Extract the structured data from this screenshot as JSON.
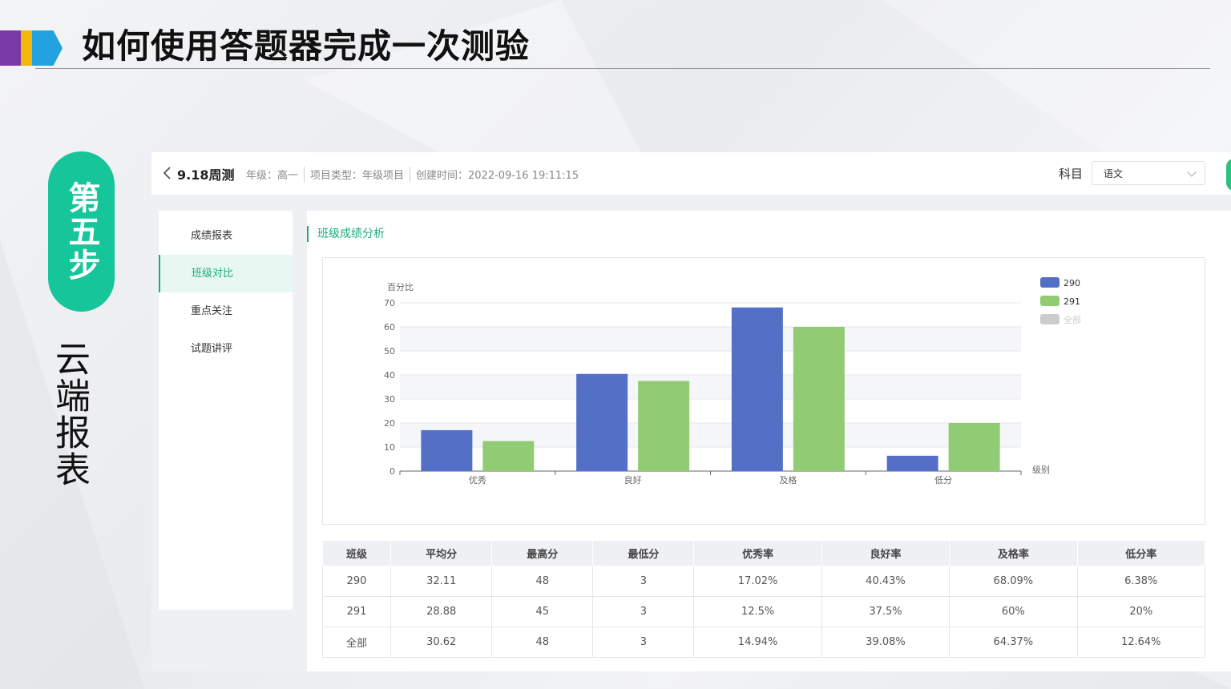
{
  "slide": {
    "title": "如何使用答题器完成一次测验",
    "step_badge": "第五步",
    "section_label": "云端报表"
  },
  "colors": {
    "accent": "#1aad7f",
    "series_290": "#5470c6",
    "series_291": "#91cc75",
    "series_all": "#cccccc",
    "step_pill": "#16c59a"
  },
  "header": {
    "exam_name": "9.18周测",
    "grade": "年级：高一",
    "project_type": "项目类型：年级项目",
    "created": "创建时间：2022-09-16 19:11:15",
    "subject_label": "科目",
    "subject_value": "语文"
  },
  "sidebar": {
    "items": [
      {
        "label": "成绩报表",
        "active": false
      },
      {
        "label": "班级对比",
        "active": true
      },
      {
        "label": "重点关注",
        "active": false
      },
      {
        "label": "试题讲评",
        "active": false
      }
    ]
  },
  "main": {
    "section_title": "班级成绩分析"
  },
  "chart_data": {
    "type": "bar",
    "ylabel": "百分比",
    "xlabel": "级别",
    "ylim": [
      0,
      70
    ],
    "yticks": [
      0,
      10,
      20,
      30,
      40,
      50,
      60,
      70
    ],
    "categories": [
      "优秀",
      "良好",
      "及格",
      "低分"
    ],
    "series": [
      {
        "name": "290",
        "values": [
          17.02,
          40.43,
          68.09,
          6.38
        ],
        "color": "#5470c6"
      },
      {
        "name": "291",
        "values": [
          12.5,
          37.5,
          60,
          20
        ],
        "color": "#91cc75"
      }
    ],
    "legend": [
      {
        "name": "290",
        "color": "#5470c6",
        "active": true
      },
      {
        "name": "291",
        "color": "#91cc75",
        "active": true
      },
      {
        "name": "全部",
        "color": "#cccccc",
        "active": false
      }
    ],
    "legend_position": "top-right",
    "grid": true
  },
  "table": {
    "headers": [
      "班级",
      "平均分",
      "最高分",
      "最低分",
      "优秀率",
      "良好率",
      "及格率",
      "低分率"
    ],
    "rows": [
      [
        "290",
        "32.11",
        "48",
        "3",
        "17.02%",
        "40.43%",
        "68.09%",
        "6.38%"
      ],
      [
        "291",
        "28.88",
        "45",
        "3",
        "12.5%",
        "37.5%",
        "60%",
        "20%"
      ],
      [
        "全部",
        "30.62",
        "48",
        "3",
        "14.94%",
        "39.08%",
        "64.37%",
        "12.64%"
      ]
    ]
  }
}
